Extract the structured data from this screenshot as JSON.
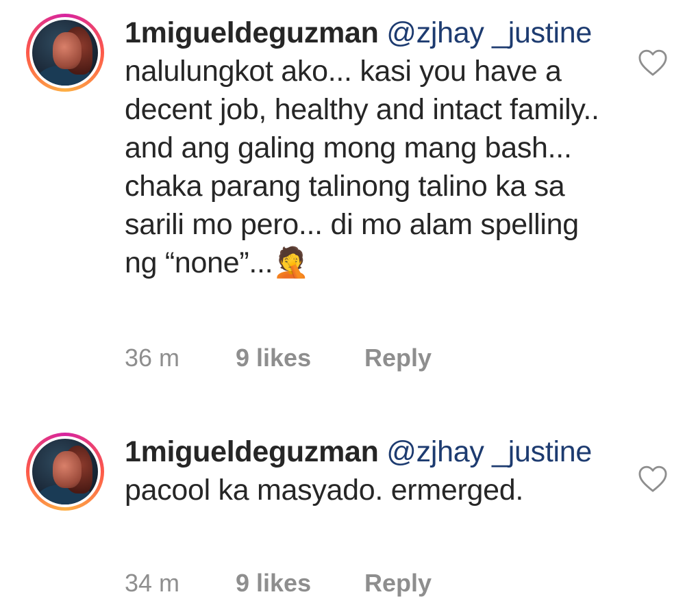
{
  "comments": [
    {
      "username": "1migueldeguzman",
      "mention": "@zjhay _justine",
      "text": "nalulungkot ako... kasi you have a decent job, healthy and intact family.. and ang galing mong mang bash... chaka parang talinong talino ka sa sarili mo pero... di mo alam spelling ng “none”...",
      "emoji_glyph": "🤦",
      "time": "36 m",
      "likes": "9 likes",
      "reply_label": "Reply",
      "like_icon": "heart-outline-icon"
    },
    {
      "username": "1migueldeguzman",
      "mention": "@zjhay _justine",
      "text": "pacool ka masyado. ermerged.",
      "time": "34 m",
      "likes": "9 likes",
      "reply_label": "Reply",
      "like_icon": "heart-outline-icon"
    }
  ],
  "colors": {
    "mention": "#1d3b70",
    "meta": "#8e8e8e",
    "ring_start": "#d6249f",
    "ring_end": "#fdb044"
  }
}
